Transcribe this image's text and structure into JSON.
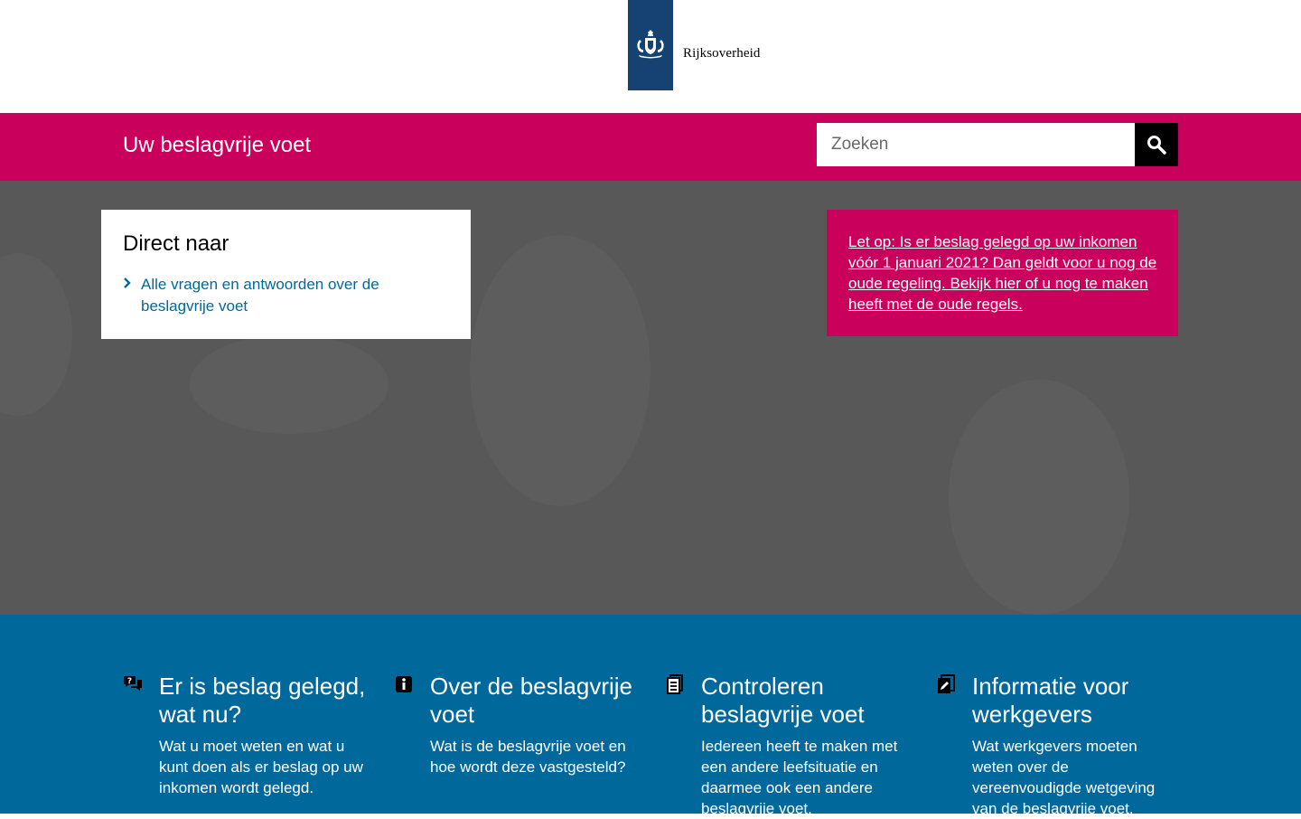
{
  "brand": {
    "logo_text": "Rijksoverheid",
    "logo_color": "#154273"
  },
  "header": {
    "site_title": "Uw beslagvrije voet",
    "search_placeholder": "Zoeken",
    "search_button_icon": "search-icon",
    "accent_color": "#ca005d"
  },
  "direct": {
    "title": "Direct naar",
    "links": [
      {
        "label": "Alle vragen en antwoorden over de beslagvrije voet"
      }
    ]
  },
  "notice": {
    "text": "Let op: Is er beslag gelegd op uw inkomen vóór 1 januari 2021? Dan geldt voor u nog de oude regeling. Bekijk hier of u nog te maken heeft met de oude regels."
  },
  "topics": [
    {
      "icon": "chat-question-icon",
      "title": "Er is beslag gelegd, wat nu?",
      "description": "Wat u moet weten en wat u kunt doen als er beslag op uw inkomen wordt gelegd."
    },
    {
      "icon": "info-icon",
      "title": "Over de beslagvrije voet",
      "description": "Wat is de beslagvrije voet en hoe wordt deze vastgesteld?"
    },
    {
      "icon": "document-icon",
      "title": "Controleren beslagvrije voet",
      "description": "Iedereen heeft te maken met een andere leefsituatie en daarmee ook een andere beslagvrije voet."
    },
    {
      "icon": "edit-document-icon",
      "title": "Informatie voor werkgevers",
      "description": "Wat werkgevers moeten weten over de vereenvoudigde wetgeving van de beslagvrije voet."
    }
  ],
  "colors": {
    "topic_band": "#01689b",
    "hero": "#585858"
  }
}
